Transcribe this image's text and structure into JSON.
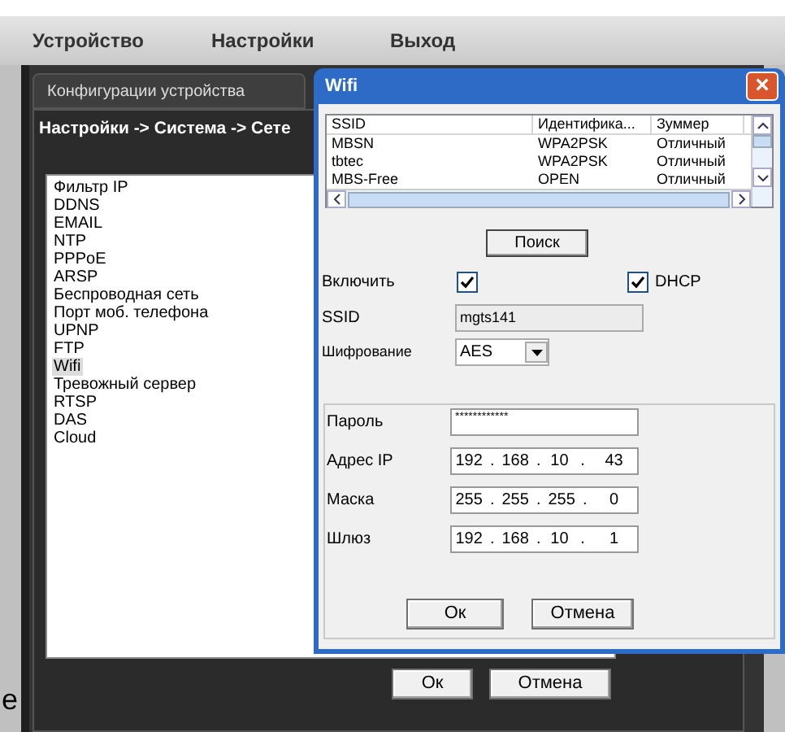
{
  "menu": [
    {
      "label": "Устройство"
    },
    {
      "label": "Настройки"
    },
    {
      "label": "Выход"
    }
  ],
  "config_window": {
    "tab": "Конфигурации устройства",
    "breadcrumb": "Настройки -> Система -> Сете",
    "items": [
      {
        "label": "Фильтр IP",
        "selected": false
      },
      {
        "label": "DDNS",
        "selected": false
      },
      {
        "label": "EMAIL",
        "selected": false
      },
      {
        "label": "NTP",
        "selected": false
      },
      {
        "label": "PPPoE",
        "selected": false
      },
      {
        "label": "ARSP",
        "selected": false
      },
      {
        "label": "Беспроводная сеть",
        "selected": false
      },
      {
        "label": "Порт моб. телефона",
        "selected": false
      },
      {
        "label": "UPNP",
        "selected": false
      },
      {
        "label": "FTP",
        "selected": false
      },
      {
        "label": "Wifi",
        "selected": true
      },
      {
        "label": "Тревожный сервер",
        "selected": false
      },
      {
        "label": "RTSP",
        "selected": false
      },
      {
        "label": "DAS",
        "selected": false
      },
      {
        "label": "Cloud",
        "selected": false
      }
    ],
    "buttons": [
      "Ок",
      "Отмена"
    ]
  },
  "page_fragment": "e",
  "wifi_dialog": {
    "title": "Wifi",
    "close": "×",
    "table": {
      "columns": [
        "SSID",
        "Идентифика...",
        "Зуммер"
      ],
      "rows": [
        [
          "MBSN",
          "WPA2PSK",
          "Отличный"
        ],
        [
          "tbtec",
          "WPA2PSK",
          "Отличный"
        ],
        [
          "MBS-Free",
          "OPEN",
          "Отличный"
        ]
      ]
    },
    "search_button": "Поиск",
    "enable": {
      "label": "Включить",
      "checked": true
    },
    "dhcp": {
      "label": "DHCP",
      "checked": true
    },
    "ssid": {
      "label": "SSID",
      "value": "mgts141"
    },
    "encryption": {
      "label": "Шифрование",
      "value": "AES"
    },
    "password": {
      "label": "Пароль",
      "value": "************"
    },
    "ip_fields": [
      {
        "label": "Адрес IP",
        "octets": [
          "192",
          "168",
          "10",
          "43"
        ],
        "separators": [
          ".",
          ".",
          "."
        ]
      },
      {
        "label": "Маска",
        "octets": [
          "255",
          "255",
          "255",
          "0"
        ],
        "separators": [
          ".",
          ".",
          "."
        ]
      },
      {
        "label": "Шлюз",
        "octets": [
          "192",
          "168",
          "10",
          "1"
        ],
        "separators": [
          ".",
          ".",
          "."
        ]
      }
    ],
    "buttons": [
      "Ок",
      "Отмена"
    ]
  }
}
